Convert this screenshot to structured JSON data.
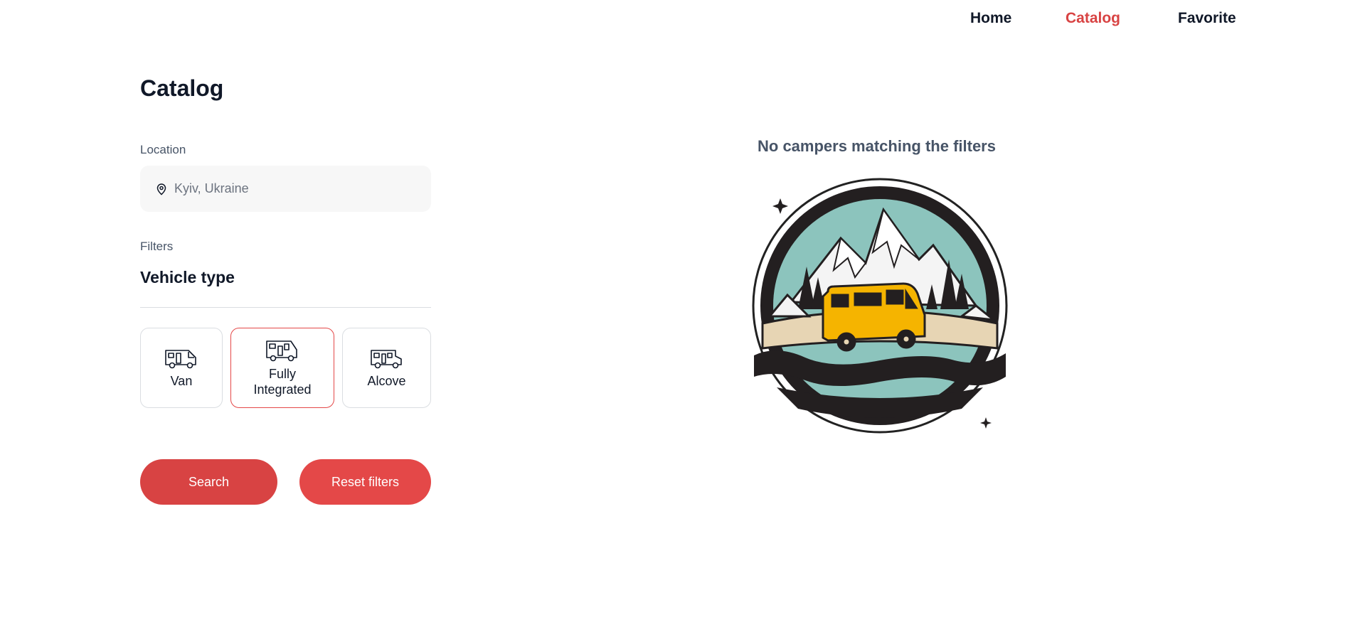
{
  "nav": {
    "items": [
      {
        "label": "Home",
        "active": false
      },
      {
        "label": "Catalog",
        "active": true
      },
      {
        "label": "Favorite",
        "active": false
      }
    ]
  },
  "catalog": {
    "title": "Catalog"
  },
  "location": {
    "label": "Location",
    "placeholder": "Kyiv, Ukraine",
    "value": "",
    "icon": "map-pin-icon"
  },
  "filters": {
    "label": "Filters",
    "vehicle_type_heading": "Vehicle type",
    "vehicle_types": [
      {
        "label": "Van",
        "selected": false,
        "icon": "van-camper-icon"
      },
      {
        "label": "Fully Integrated",
        "selected": true,
        "icon": "fully-integrated-camper-icon"
      },
      {
        "label": "Alcove",
        "selected": false,
        "icon": "alcove-camper-icon"
      }
    ]
  },
  "buttons": {
    "search": "Search",
    "reset": "Reset filters"
  },
  "empty_state": {
    "message": "No campers matching the filters",
    "illustration": "camper-van-mountains-illustration"
  },
  "colors": {
    "accent": "#d84343",
    "accent_light": "#e44848",
    "text": "#101828",
    "muted": "#475467",
    "input_bg": "#f7f7f7",
    "border": "#dadde1",
    "van_yellow": "#f5b400",
    "sky": "#8cc4bd"
  }
}
